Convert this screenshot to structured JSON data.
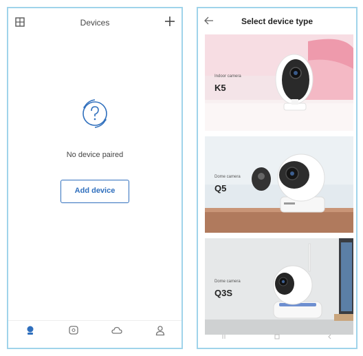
{
  "left_screen": {
    "header": {
      "title": "Devices"
    },
    "empty_state": {
      "message": "No device paired",
      "button_label": "Add device"
    },
    "bottom_nav": [
      {
        "icon": "device-icon",
        "label": "",
        "active": true
      },
      {
        "icon": "message-icon",
        "label": ""
      },
      {
        "icon": "cloud-icon",
        "label": ""
      },
      {
        "icon": "user-icon",
        "label": ""
      }
    ]
  },
  "right_screen": {
    "header": {
      "title": "Select device type"
    },
    "cards": [
      {
        "caption": "Indoor camera",
        "model": "K5"
      },
      {
        "caption": "Dome camera",
        "model": "Q5"
      },
      {
        "caption": "Dome camera",
        "model": "Q3S"
      }
    ]
  },
  "colors": {
    "accent": "#2f6fbd",
    "frame": "#9fd3ea"
  }
}
